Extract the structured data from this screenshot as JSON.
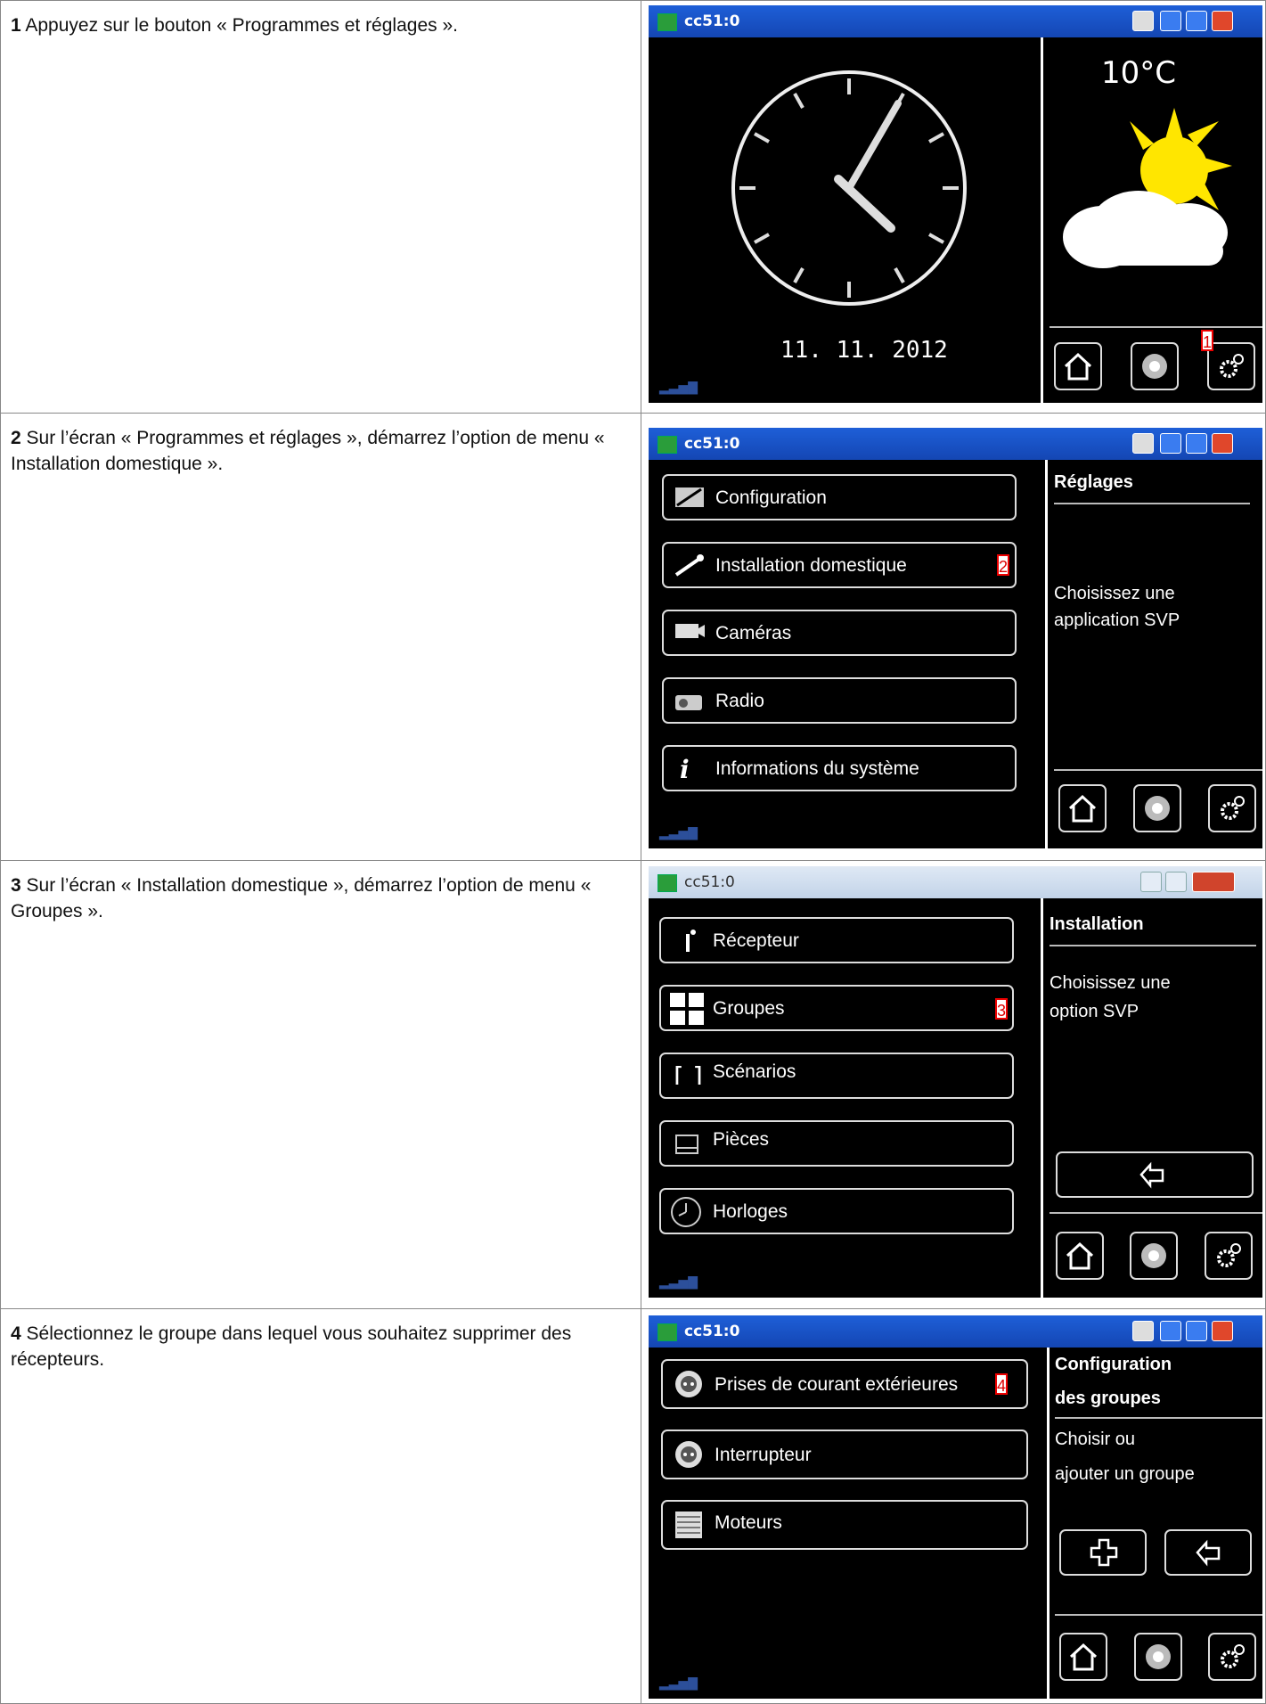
{
  "steps": [
    {
      "number": "1",
      "text": " Appuyez sur le bouton « Programmes et réglages ».",
      "screen": {
        "title": "cc51:0",
        "temperature": "10°C",
        "date": "11. 11. 2012",
        "marker": "1"
      }
    },
    {
      "number": "2",
      "text": " Sur l’écran « Programmes et réglages », démarrez l’option de menu « Installation domestique ».",
      "screen": {
        "title": "cc51:0",
        "menu": [
          "Configuration",
          "Installation domestique",
          "Caméras",
          "Radio",
          "Informations du système"
        ],
        "side_title": "Réglages",
        "side_text_1": "Choisissez une",
        "side_text_2": "application SVP",
        "marker": "2"
      }
    },
    {
      "number": "3",
      "text": " Sur l’écran « Installation domestique », démarrez l’option de menu « Groupes ».",
      "screen": {
        "title": "cc51:0",
        "menu": [
          "Récepteur",
          "Groupes",
          "Scénarios",
          "Pièces",
          "Horloges"
        ],
        "side_title": "Installation",
        "side_text_1": "Choisissez une",
        "side_text_2": "option SVP",
        "marker": "3"
      }
    },
    {
      "number": "4",
      "text": " Sélectionnez le groupe dans lequel vous souhaitez supprimer des récepteurs.",
      "screen": {
        "title": "cc51:0",
        "menu": [
          "Prises de courant extérieures",
          "Interrupteur",
          "Moteurs"
        ],
        "side_title_1": "Configuration",
        "side_title_2": "des groupes",
        "side_text_1": "Choisir ou",
        "side_text_2": "ajouter un groupe",
        "marker": "4"
      }
    }
  ],
  "icons": {
    "home": "home-icon",
    "network": "network-icon",
    "settings": "gear-icon",
    "back": "back-arrow-icon",
    "add": "plus-icon"
  }
}
